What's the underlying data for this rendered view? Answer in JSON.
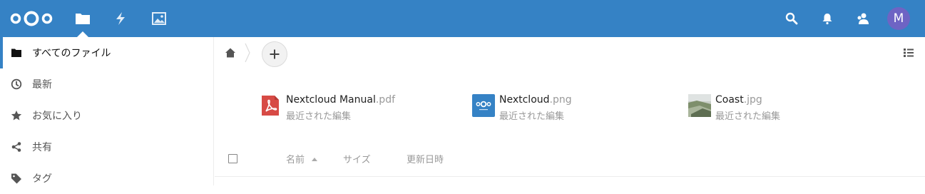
{
  "header": {
    "logo": "nextcloud-logo",
    "apps": [
      {
        "icon": "folder-icon",
        "active": true
      },
      {
        "icon": "activity-icon",
        "active": false
      },
      {
        "icon": "gallery-icon",
        "active": false
      }
    ],
    "right_icons": [
      "search-icon",
      "notifications-icon",
      "contacts-icon"
    ],
    "avatar_initial": "M",
    "colors": {
      "bar": "#3582c5",
      "avatar": "#6e64c4"
    }
  },
  "sidebar": {
    "items": [
      {
        "label": "すべてのファイル",
        "icon": "folder-icon",
        "active": true
      },
      {
        "label": "最新",
        "icon": "clock-icon",
        "active": false
      },
      {
        "label": "お気に入り",
        "icon": "star-icon",
        "active": false
      },
      {
        "label": "共有",
        "icon": "share-icon",
        "active": false
      },
      {
        "label": "タグ",
        "icon": "tag-icon",
        "active": false
      }
    ]
  },
  "main": {
    "breadcrumb": {
      "home_icon": "home-icon",
      "add_label": "+"
    },
    "recent_files": [
      {
        "name": "Nextcloud Manual",
        "ext": ".pdf",
        "subtitle": "最近された編集",
        "icon": "pdf-icon"
      },
      {
        "name": "Nextcloud",
        "ext": ".png",
        "subtitle": "最近された編集",
        "icon": "nextcloud-image-thumbnail"
      },
      {
        "name": "Coast",
        "ext": ".jpg",
        "subtitle": "最近された編集",
        "icon": "coast-image-thumbnail"
      }
    ],
    "list_header": {
      "name": "名前",
      "size": "サイズ",
      "modified": "更新日時"
    }
  }
}
